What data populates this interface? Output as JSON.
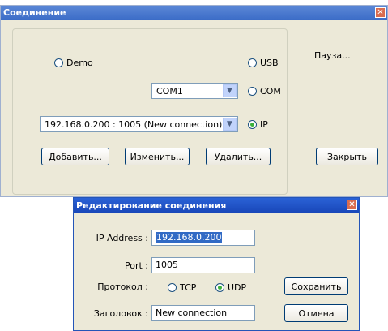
{
  "main_window": {
    "title": "Соединение",
    "close_glyph": "✕",
    "radio_demo": "Demo",
    "radio_usb": "USB",
    "radio_com": "COM",
    "radio_ip": "IP",
    "selected_radio": "IP",
    "com_port_value": "COM1",
    "connection_value": "192.168.0.200 : 1005 (New connection)",
    "pause_label": "Пауза...",
    "add_button": "Добавить...",
    "edit_button": "Изменить...",
    "delete_button": "Удалить...",
    "close_button": "Закрыть"
  },
  "edit_dialog": {
    "title": "Редактирование соединения",
    "close_glyph": "✕",
    "ip_label": "IP Address :",
    "ip_value": "192.168.0.200",
    "port_label": "Port :",
    "port_value": "1005",
    "protocol_label": "Протокол :",
    "protocol_tcp": "TCP",
    "protocol_udp": "UDP",
    "selected_protocol": "UDP",
    "caption_label": "Заголовок :",
    "caption_value": "New connection",
    "save_button": "Сохранить",
    "cancel_button": "Отмена"
  },
  "colors": {
    "titlebar": "#3b6cc7",
    "dialog_titlebar": "#1846b8",
    "window_bg": "#ece9d8",
    "selection": "#316ac5",
    "radio_dot": "#3bb03b"
  }
}
